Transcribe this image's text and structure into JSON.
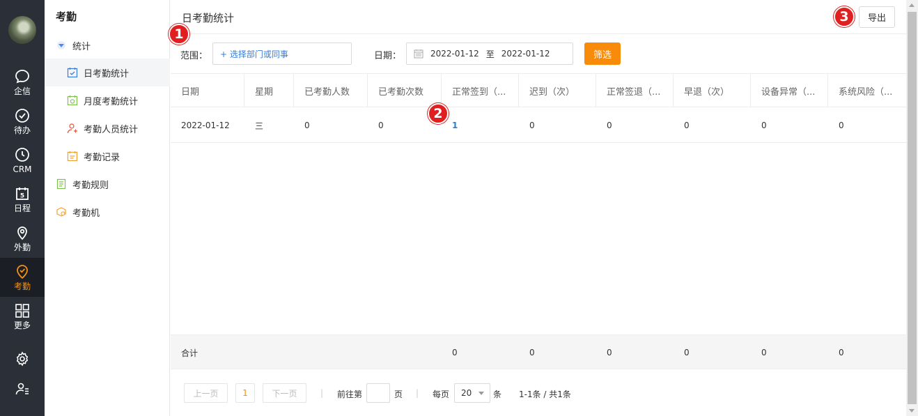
{
  "nav": {
    "items": [
      {
        "label": "企信",
        "icon": "chat-bubble-icon"
      },
      {
        "label": "待办",
        "icon": "check-circle-icon"
      },
      {
        "label": "CRM",
        "icon": "clock-icon"
      },
      {
        "label": "日程",
        "icon": "calendar-5-icon"
      },
      {
        "label": "外勤",
        "icon": "location-pin-icon"
      },
      {
        "label": "考勤",
        "icon": "attendance-check-icon"
      },
      {
        "label": "更多",
        "icon": "grid-icon"
      }
    ],
    "active": "考勤",
    "bottom_icons": [
      "settings-gear-icon",
      "user-list-icon"
    ]
  },
  "sub_sidebar": {
    "title": "考勤",
    "group": "统计",
    "children": [
      {
        "label": "日考勤统计",
        "icon": "calendar-check-icon"
      },
      {
        "label": "月度考勤统计",
        "icon": "calendar-money-icon"
      },
      {
        "label": "考勤人员统计",
        "icon": "user-stats-icon"
      },
      {
        "label": "考勤记录",
        "icon": "record-calendar-icon"
      }
    ],
    "top_items": [
      {
        "label": "考勤规则",
        "icon": "rules-doc-icon"
      },
      {
        "label": "考勤机",
        "icon": "attendance-machine-icon"
      }
    ],
    "active": "日考勤统计"
  },
  "main": {
    "title": "日考勤统计",
    "export_label": "导出",
    "filters": {
      "scope_label": "范围：",
      "scope_placeholder": "+ 选择部门或同事",
      "date_label": "日期：",
      "date_start": "2022-01-12",
      "date_sep": "至",
      "date_end": "2022-01-12",
      "filter_button": "筛选"
    },
    "table": {
      "headers": [
        "日期",
        "星期",
        "已考勤人数",
        "已考勤次数",
        "正常签到（...",
        "迟到（次）",
        "正常签退（...",
        "早退（次）",
        "设备异常（...",
        "系统风险（..."
      ],
      "rows": [
        [
          "2022-01-12",
          "三",
          "0",
          "0",
          "1",
          "0",
          "0",
          "0",
          "0",
          "0"
        ]
      ],
      "total": {
        "label": "合计",
        "values": [
          "0",
          "0",
          "0",
          "0",
          "0",
          "0"
        ]
      }
    },
    "pagination": {
      "prev": "上一页",
      "current_page": "1",
      "next": "下一页",
      "goto_prefix": "前往第",
      "goto_suffix": "页",
      "per_page_label": "每页",
      "per_page_value": "20",
      "per_page_unit": "条",
      "summary": "1-1条 / 共1条"
    }
  },
  "markers": [
    "1",
    "2",
    "3"
  ],
  "colors": {
    "nav_bg": "#2b3038",
    "active_orange": "#f88b0a",
    "link_blue": "#2a7fd0",
    "marker_red": "#e02020"
  }
}
